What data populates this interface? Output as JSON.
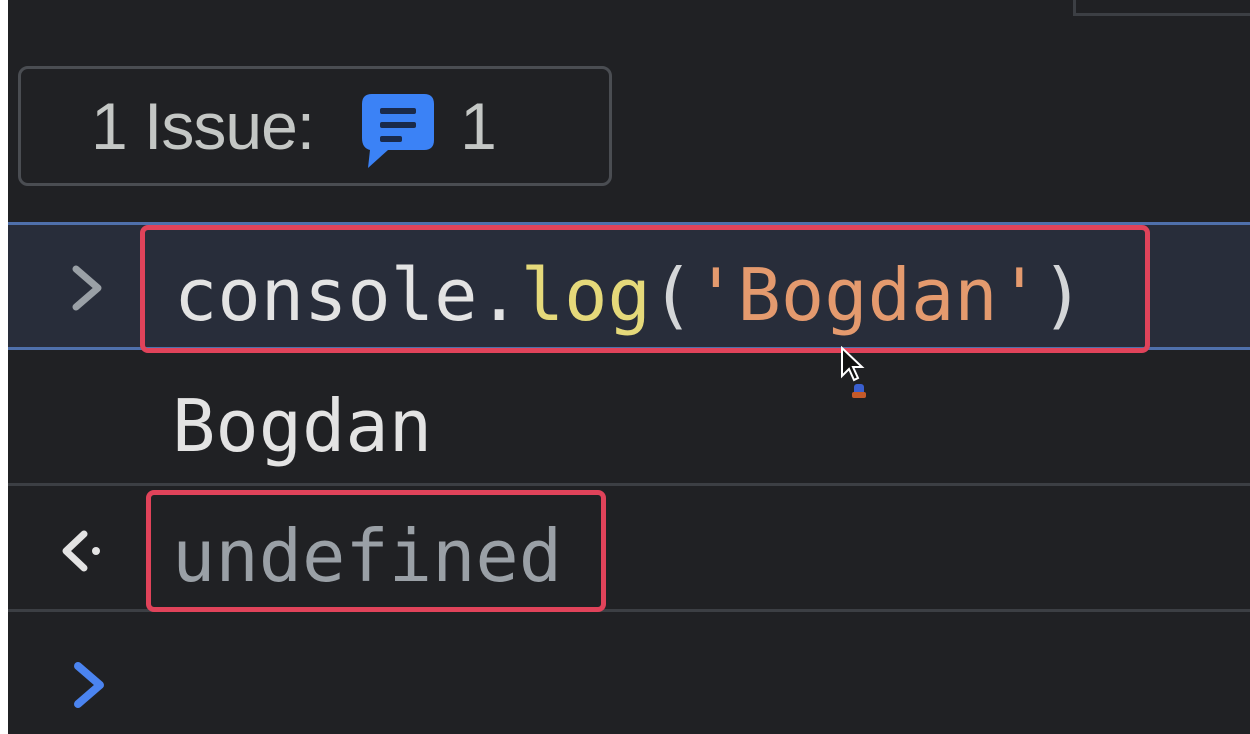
{
  "issues": {
    "label": "1 Issue:",
    "count": "1",
    "icon": "message-icon",
    "icon_color": "#3b82f6"
  },
  "console": {
    "input": {
      "prompt_icon": "chevron-right-icon",
      "tokens": {
        "object": "console",
        "dot": ".",
        "method": "log",
        "open_paren": "(",
        "string": "'Bogdan'",
        "close_paren": ")"
      }
    },
    "output": {
      "text": "Bogdan"
    },
    "result": {
      "return_icon": "return-arrow-icon",
      "text": "undefined"
    },
    "prompt": {
      "icon": "chevron-right-icon",
      "accent": "#4b84f0"
    }
  },
  "colors": {
    "background": "#202124",
    "input_row": "#282d3a",
    "highlight": "#e0435a",
    "method": "#e5d97a",
    "string": "#e49a6e"
  }
}
